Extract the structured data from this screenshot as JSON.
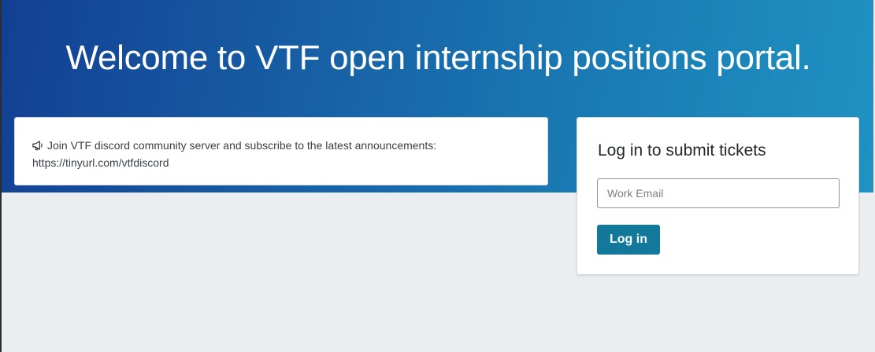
{
  "hero": {
    "title": "Welcome to VTF open internship positions portal."
  },
  "announcement": {
    "icon": "megaphone-icon",
    "text": "Join VTF discord community server and subscribe to the latest announcements:",
    "link": "https://tinyurl.com/vtfdiscord"
  },
  "login": {
    "title": "Log in to submit tickets",
    "email_placeholder": "Work Email",
    "email_value": "",
    "button_label": "Log in"
  },
  "colors": {
    "hero_gradient_start": "#133f93",
    "hero_gradient_end": "#1f92c2",
    "button": "#13799a",
    "page_background": "#ebeef0"
  }
}
